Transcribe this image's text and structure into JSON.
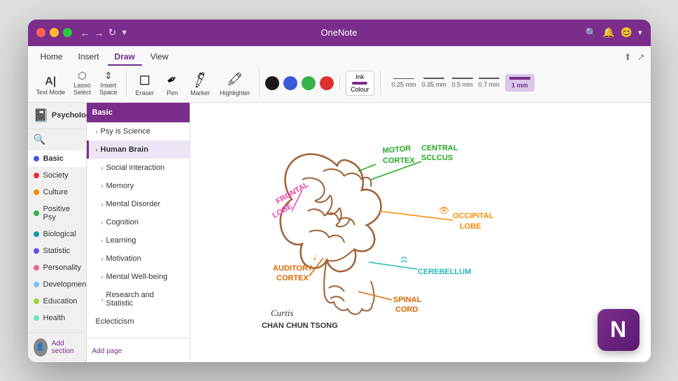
{
  "window": {
    "title": "OneNote"
  },
  "titlebar": {
    "buttons": [
      "close",
      "minimize",
      "maximize"
    ],
    "nav": [
      "back",
      "forward",
      "refresh",
      "settings"
    ],
    "right_icons": [
      "bell",
      "smiley",
      "chevron"
    ],
    "share_icon": "share"
  },
  "ribbon": {
    "tabs": [
      {
        "label": "Home",
        "active": false
      },
      {
        "label": "Insert",
        "active": false
      },
      {
        "label": "Draw",
        "active": true
      },
      {
        "label": "View",
        "active": false
      }
    ],
    "tools": {
      "group1": [
        {
          "label": "Text\nMode",
          "icon": "⬚"
        },
        {
          "label": "Lasso\nSelect",
          "icon": "⬡"
        },
        {
          "label": "Insert\nSpace",
          "icon": "↕"
        }
      ],
      "eraser_label": "Eraser",
      "pen_label": "Pen",
      "marker_label": "Marker",
      "highlighter_label": "Highlighter"
    },
    "colors": [
      "#1a1a1a",
      "#3b5bdb",
      "#37b24d",
      "#e03131"
    ],
    "ink_colour_label": "Ink\nColour",
    "thicknesses": [
      {
        "label": "0.25 mm",
        "active": false
      },
      {
        "label": "0.35 mm",
        "active": false
      },
      {
        "label": "0.5 mm",
        "active": false
      },
      {
        "label": "0.7 mm",
        "active": false
      },
      {
        "label": "1 mm",
        "active": true
      }
    ]
  },
  "sidebar": {
    "notebook_name": "Psychology",
    "sections": [
      {
        "label": "Basic",
        "color": "#3b5bdb",
        "active": true
      },
      {
        "label": "Society",
        "color": "#e03131"
      },
      {
        "label": "Culture",
        "color": "#f08c00"
      },
      {
        "label": "Positive Psy",
        "color": "#37b24d"
      },
      {
        "label": "Biological",
        "color": "#1098ad"
      },
      {
        "label": "Statistic",
        "color": "#7048e8"
      },
      {
        "label": "Personality",
        "color": "#f06595"
      },
      {
        "label": "Developmental",
        "color": "#74c0fc"
      },
      {
        "label": "Education",
        "color": "#94d82d"
      },
      {
        "label": "Health",
        "color": "#63e6be"
      }
    ],
    "add_section_label": "Add section"
  },
  "pages": {
    "section_title": "Basic",
    "items": [
      {
        "label": "Psy is Science",
        "active": false,
        "sub": false
      },
      {
        "label": "Human Brain",
        "active": true,
        "sub": false
      },
      {
        "label": "Social interaction",
        "active": false,
        "sub": true
      },
      {
        "label": "Memory",
        "active": false,
        "sub": true
      },
      {
        "label": "Mental Disorder",
        "active": false,
        "sub": true
      },
      {
        "label": "Cognition",
        "active": false,
        "sub": true
      },
      {
        "label": "Learning",
        "active": false,
        "sub": true
      },
      {
        "label": "Motivation",
        "active": false,
        "sub": true
      },
      {
        "label": "Mental Well-being",
        "active": false,
        "sub": true
      },
      {
        "label": "Research and Statistic",
        "active": false,
        "sub": true
      },
      {
        "label": "Eclecticism",
        "active": false,
        "sub": false
      }
    ],
    "add_page_label": "Add page"
  },
  "canvas": {
    "brain_labels": {
      "motor_cortex": "MOTOR\nCORTEX",
      "central_sulcus": "CENTRAL\nSCLCUS",
      "frontal_lobe": "FRONTAL\nLOBE",
      "occipital_lobe": "OCCIPITAL\nLOBE",
      "auditory_cortex": "AUDITORY\nCORTEX",
      "cerebellum": "CEREBELLUM",
      "spinal_cord": "SPINAL\nCORD",
      "note_symbol": "♩",
      "balance_symbol": "⚖",
      "eye_symbol": "👁"
    },
    "signature": "Curtis\nCHAN CHUN TSONG"
  },
  "logo": {
    "letter": "N"
  }
}
